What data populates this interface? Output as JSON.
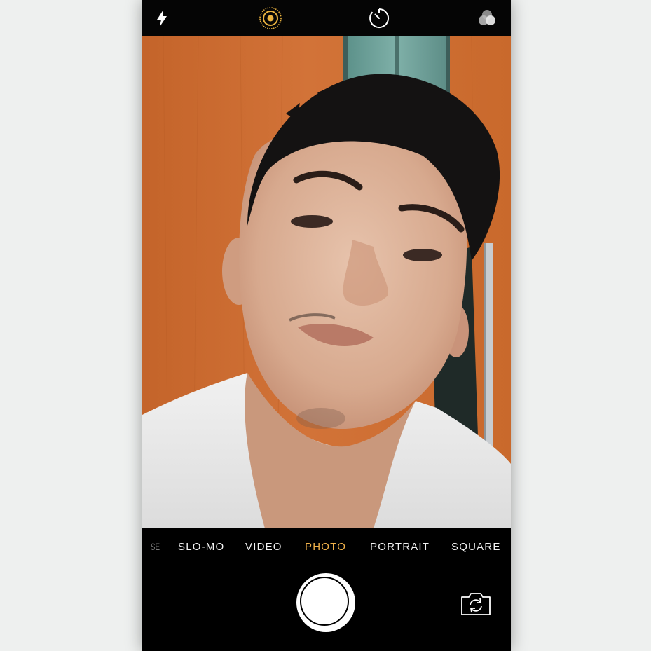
{
  "camera": {
    "top_controls": [
      "flash-icon",
      "live-photo-icon",
      "timer-icon",
      "filters-icon"
    ],
    "modes": [
      {
        "label": "SE",
        "state": "faded"
      },
      {
        "label": "SLO-MO",
        "state": "normal"
      },
      {
        "label": "VIDEO",
        "state": "normal"
      },
      {
        "label": "PHOTO",
        "state": "active"
      },
      {
        "label": "PORTRAIT",
        "state": "normal"
      },
      {
        "label": "SQUARE",
        "state": "normal"
      }
    ],
    "bottom_controls": [
      "shutter-button",
      "switch-camera-icon"
    ],
    "colors": {
      "active_mode": "#f0b14a",
      "live_photo": "#e9b23f",
      "background": "#000000",
      "page_background": "#eef0ef"
    }
  }
}
